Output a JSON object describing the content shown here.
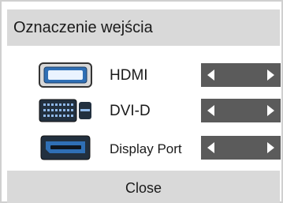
{
  "title": "Oznaczenie wejścia",
  "inputs": [
    {
      "label": "HDMI",
      "icon": "hdmi-port-icon"
    },
    {
      "label": "DVI-D",
      "icon": "dvi-port-icon"
    },
    {
      "label": "Display Port",
      "icon": "displayport-port-icon"
    }
  ],
  "selector_icons": {
    "left": "arrow-left-icon",
    "right": "arrow-right-icon"
  },
  "close_label": "Close",
  "colors": {
    "header_bg": "#d9d9d9",
    "selector_bg": "#5b5b5b",
    "port_blue": "#2f6fb5",
    "port_dark": "#22303f"
  }
}
